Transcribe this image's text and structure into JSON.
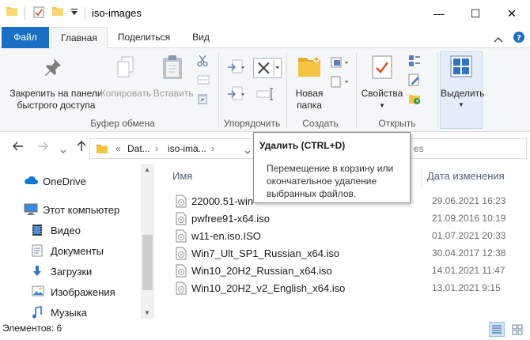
{
  "window": {
    "title": "iso-images",
    "minimize_glyph": "—",
    "maximize_glyph": "☐",
    "close_glyph": "✕"
  },
  "tabs": [
    {
      "label": "Файл"
    },
    {
      "label": "Главная"
    },
    {
      "label": "Поделиться"
    },
    {
      "label": "Вид"
    }
  ],
  "ribbon": {
    "pin_label_line1": "Закрепить на панели",
    "pin_label_line2": "быстрого доступа",
    "copy_label": "Копировать",
    "paste_label": "Вставить",
    "clipboard_group": "Буфер обмена",
    "organize_group": "Упорядочить",
    "new_folder_line1": "Новая",
    "new_folder_line2": "папка",
    "create_group": "Создать",
    "properties_label": "Свойства",
    "open_group": "Открыть",
    "select_label": "Выделить"
  },
  "address": {
    "overflow": "«",
    "crumb1": "Dat...",
    "crumb2": "iso-ima...",
    "search_fragment": "es"
  },
  "navpane": {
    "items": [
      {
        "label": "OneDrive"
      },
      {
        "label": "Этот компьютер"
      },
      {
        "label": "Видео"
      },
      {
        "label": "Документы"
      },
      {
        "label": "Загрузки"
      },
      {
        "label": "Изображения"
      },
      {
        "label": "Музыка"
      }
    ]
  },
  "filelist": {
    "columns": {
      "name": "Имя",
      "date": "Дата изменения"
    },
    "rows": [
      {
        "name": "22000.51-win",
        "date": "29.06.2021 16:23"
      },
      {
        "name": "pwfree91-x64.iso",
        "date": "21.09.2016 10:19"
      },
      {
        "name": "w11-en.iso.ISO",
        "date": "01.07.2021 20:33"
      },
      {
        "name": "Win7_Ult_SP1_Russian_x64.iso",
        "date": "30.04.2017 12:38"
      },
      {
        "name": "Win10_20H2_Russian_x64.iso",
        "date": "14.01.2021 11:47"
      },
      {
        "name": "Win10_20H2_v2_English_x64.iso",
        "date": "13.01.2021 9:15"
      }
    ]
  },
  "status": {
    "items_count": "Элементов: 6"
  },
  "tooltip": {
    "title": "Удалить (CTRL+D)",
    "body": "Перемещение в корзину или окончательное удаление выбранных файлов."
  },
  "colors": {
    "file_tab": "#1a6fc4",
    "folder_yellow": "#f6c343",
    "onedrive_blue": "#0f78d4",
    "accent_red": "#e04a2a"
  }
}
